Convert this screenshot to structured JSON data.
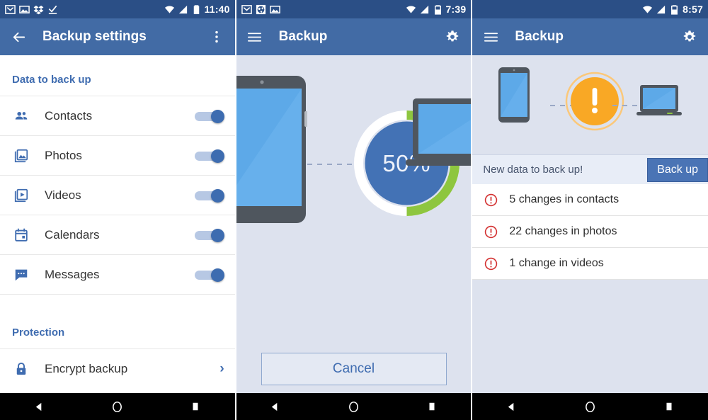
{
  "panels": [
    {
      "status": {
        "time": "11:40",
        "left_icons": [
          "gmail-icon",
          "photo-icon",
          "dropbox-icon",
          "check-download-icon"
        ],
        "right_icons": [
          "wifi-icon",
          "signal-icon",
          "battery-icon"
        ]
      },
      "appbar": {
        "nav_icon": "back-arrow-icon",
        "title": "Backup settings",
        "action_icon": "overflow-menu-icon"
      },
      "sections": [
        {
          "heading": "Data to back up",
          "rows": [
            {
              "icon": "contacts-icon",
              "label": "Contacts",
              "control": "toggle",
              "on": true
            },
            {
              "icon": "photos-icon",
              "label": "Photos",
              "control": "toggle",
              "on": true
            },
            {
              "icon": "videos-icon",
              "label": "Videos",
              "control": "toggle",
              "on": true
            },
            {
              "icon": "calendar-icon",
              "label": "Calendars",
              "control": "toggle",
              "on": true
            },
            {
              "icon": "messages-icon",
              "label": "Messages",
              "control": "toggle",
              "on": true
            }
          ]
        },
        {
          "heading": "Protection",
          "rows": [
            {
              "icon": "lock-icon",
              "label": "Encrypt backup",
              "control": "chevron",
              "chevron": "›"
            }
          ]
        }
      ]
    },
    {
      "status": {
        "time": "7:39",
        "left_icons": [
          "gmail-icon",
          "globe-icon",
          "photo-icon"
        ],
        "right_icons": [
          "wifi-icon",
          "signal-icon",
          "battery-icon"
        ]
      },
      "appbar": {
        "nav_icon": "hamburger-menu-icon",
        "title": "Backup",
        "action_icon": "gear-icon"
      },
      "progress": {
        "percent_label": "50%",
        "percent_value": 50,
        "ring_done_color": "#8ec63f",
        "ring_track_color": "#ffffff",
        "fill_color": "#4372b5"
      },
      "cancel_label": "Cancel"
    },
    {
      "status": {
        "time": "8:57",
        "left_icons": [],
        "right_icons": [
          "wifi-icon",
          "signal-icon",
          "battery-icon"
        ]
      },
      "appbar": {
        "nav_icon": "hamburger-menu-icon",
        "title": "Backup",
        "action_icon": "gear-icon"
      },
      "alert": {
        "warning_color": "#f9a825",
        "banner_text": "New data to back up!",
        "backup_button": "Back up",
        "changes": [
          {
            "icon": "alert-circle-icon",
            "label": "5 changes in contacts"
          },
          {
            "icon": "alert-circle-icon",
            "label": "22 changes in photos"
          },
          {
            "icon": "alert-circle-icon",
            "label": "1 change in videos"
          }
        ]
      }
    }
  ],
  "navbar": {
    "back": "back-triangle-icon",
    "home": "home-circle-icon",
    "recents": "recents-square-icon"
  },
  "colors": {
    "statusbar": "#2b4f86",
    "appbar": "#426ba5",
    "accent": "#3f6cb0",
    "canvas": "#dde2ee",
    "alert_red": "#d32f2f",
    "warning_orange": "#f9a825",
    "progress_green": "#8ec63f"
  }
}
